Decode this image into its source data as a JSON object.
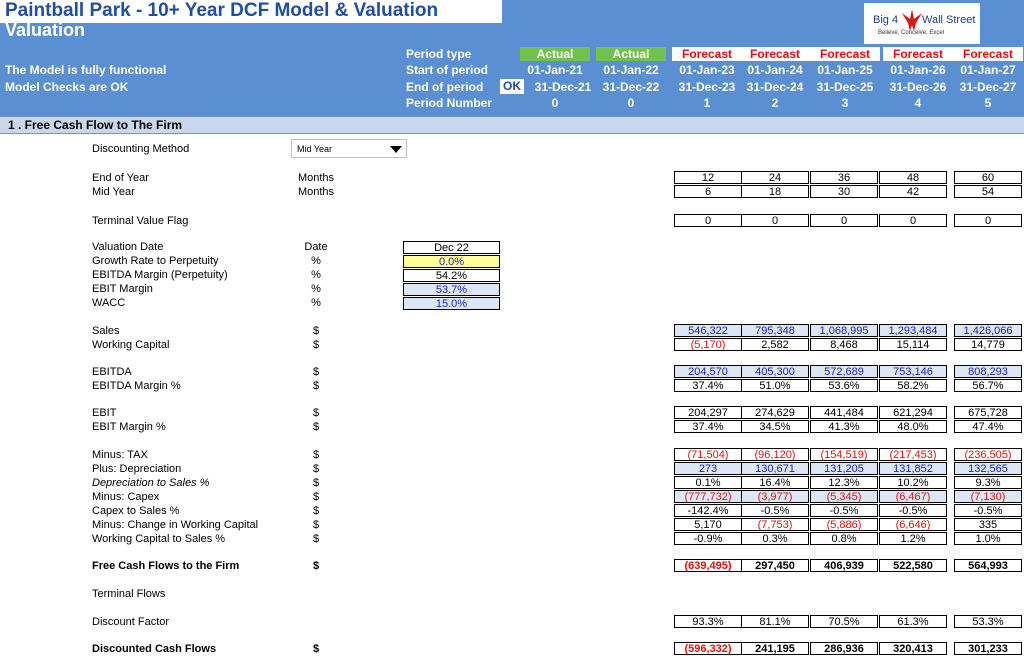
{
  "header": {
    "title": "Paintball Park - 10+ Year DCF Model & Valuation",
    "subtitle": "Valuation",
    "status1": "The Model is fully functional",
    "status2": "Model Checks are OK",
    "ok_badge": "OK",
    "logo": {
      "left": "Big 4",
      "right": "Wall Street",
      "tagline": "Believe, Conceive, Excel"
    },
    "row_labels": [
      "Period type",
      "Start of period",
      "End of period",
      "Period Number"
    ],
    "period_types": [
      "Actual",
      "Actual",
      "Forecast",
      "Forecast",
      "Forecast",
      "Forecast",
      "Forecast"
    ],
    "start_dates": [
      "01-Jan-21",
      "01-Jan-22",
      "01-Jan-23",
      "01-Jan-24",
      "01-Jan-25",
      "01-Jan-26",
      "01-Jan-27"
    ],
    "end_dates": [
      "31-Dec-21",
      "31-Dec-22",
      "31-Dec-23",
      "31-Dec-24",
      "31-Dec-25",
      "31-Dec-26",
      "31-Dec-27"
    ],
    "period_numbers": [
      "0",
      "0",
      "1",
      "2",
      "3",
      "4",
      "5"
    ]
  },
  "section": {
    "title": "1 . Free Cash Flow to The Firm"
  },
  "discounting": {
    "label": "Discounting Method",
    "value": "Mid Year"
  },
  "inputs": {
    "valuation_date": {
      "label": "Valuation Date",
      "unit": "Date",
      "value": "Dec 22"
    },
    "growth": {
      "label": "Growth Rate to Perpetuity",
      "unit": "%",
      "value": "0.0%"
    },
    "ebitda_perp": {
      "label": "EBITDA Margin (Perpetuity)",
      "unit": "%",
      "value": "54.2%"
    },
    "ebit_margin": {
      "label": "EBIT Margin",
      "unit": "%",
      "value": "53.7%"
    },
    "wacc": {
      "label": "WACC",
      "unit": "%",
      "value": "15.0%"
    }
  },
  "rows": [
    {
      "label": "End of Year",
      "unit": "Months",
      "values": [
        "12",
        "24",
        "36",
        "48",
        "60"
      ]
    },
    {
      "label": "Mid Year",
      "unit": "Months",
      "values": [
        "6",
        "18",
        "30",
        "42",
        "54"
      ]
    },
    {
      "label": "Terminal Value Flag",
      "unit": "",
      "values": [
        "0",
        "0",
        "0",
        "0",
        "0"
      ]
    },
    {
      "label": "Sales",
      "unit": "$",
      "values": [
        "546,322",
        "795,348",
        "1,068,995",
        "1,293,484",
        "1,426,066"
      ]
    },
    {
      "label": "Working Capital",
      "unit": "$",
      "values": [
        "(5,170)",
        "2,582",
        "8,468",
        "15,114",
        "14,779"
      ]
    },
    {
      "label": "EBITDA",
      "unit": "$",
      "values": [
        "204,570",
        "405,300",
        "572,689",
        "753,146",
        "808,293"
      ]
    },
    {
      "label": "EBITDA Margin %",
      "unit": "$",
      "values": [
        "37.4%",
        "51.0%",
        "53.6%",
        "58.2%",
        "56.7%"
      ]
    },
    {
      "label": "EBIT",
      "unit": "$",
      "values": [
        "204,297",
        "274,629",
        "441,484",
        "621,294",
        "675,728"
      ]
    },
    {
      "label": "EBIT Margin %",
      "unit": "$",
      "values": [
        "37.4%",
        "34.5%",
        "41.3%",
        "48.0%",
        "47.4%"
      ]
    },
    {
      "label": "Minus: TAX",
      "unit": "$",
      "values": [
        "(71,504)",
        "(96,120)",
        "(154,519)",
        "(217,453)",
        "(236,505)"
      ]
    },
    {
      "label": "Plus: Depreciation",
      "unit": "$",
      "values": [
        "273",
        "130,671",
        "131,205",
        "131,852",
        "132,565"
      ]
    },
    {
      "label": "Depreciation to Sales %",
      "unit": "$",
      "values": [
        "0.1%",
        "16.4%",
        "12.3%",
        "10.2%",
        "9.3%"
      ]
    },
    {
      "label": "Minus: Capex",
      "unit": "$",
      "values": [
        "(777,732)",
        "(3,977)",
        "(5,345)",
        "(6,467)",
        "(7,130)"
      ]
    },
    {
      "label": "Capex to Sales %",
      "unit": "$",
      "values": [
        "-142.4%",
        "-0.5%",
        "-0.5%",
        "-0.5%",
        "-0.5%"
      ]
    },
    {
      "label": "Minus: Change in Working Capital",
      "unit": "$",
      "values": [
        "5,170",
        "(7,753)",
        "(5,886)",
        "(6,646)",
        "335"
      ]
    },
    {
      "label": "Working Capital to Sales %",
      "unit": "$",
      "values": [
        "-0.9%",
        "0.3%",
        "0.8%",
        "1.2%",
        "1.0%"
      ]
    },
    {
      "label": "Free Cash Flows to the Firm",
      "unit": "$",
      "values": [
        "(639,495)",
        "297,450",
        "406,939",
        "522,580",
        "564,993"
      ]
    },
    {
      "label": "Terminal Flows",
      "unit": "",
      "values": []
    },
    {
      "label": "Discount Factor",
      "unit": "",
      "values": [
        "93.3%",
        "81.1%",
        "70.5%",
        "61.3%",
        "53.3%"
      ]
    },
    {
      "label": "Discounted Cash Flows",
      "unit": "$",
      "values": [
        "(596,332)",
        "241,195",
        "286,936",
        "320,413",
        "301,233"
      ]
    }
  ],
  "colors": {
    "header": "#5b8fd3",
    "actual": "#70c14e",
    "forecast": "#e01010",
    "input_blue": "#1a22c8",
    "title": "#1f4ea3"
  }
}
